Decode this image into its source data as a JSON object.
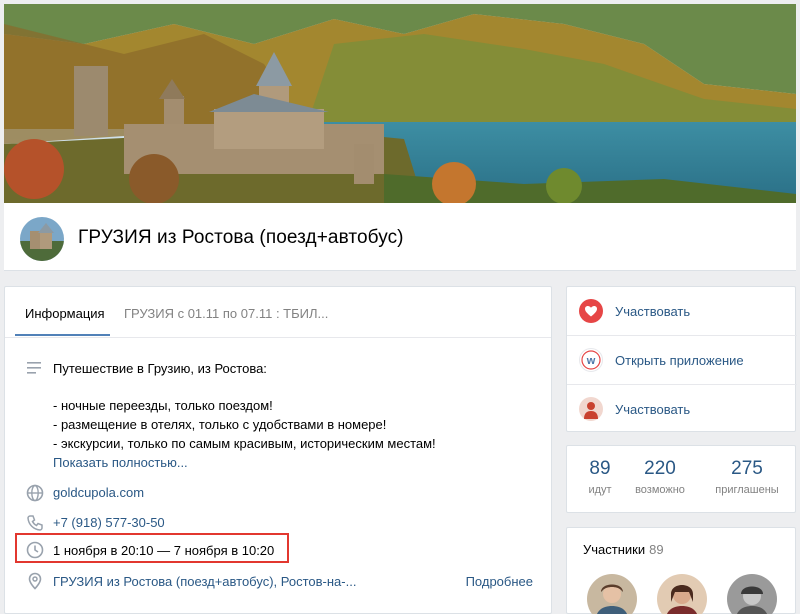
{
  "group": {
    "title": "ГРУЗИЯ из Ростова (поезд+автобус)"
  },
  "tabs": {
    "info": "Информация",
    "event": "ГРУЗИЯ с 01.11 по 07.11 : ТБИЛ..."
  },
  "description": {
    "lines": [
      "Путешествие в Грузию, из Ростова:",
      "- ночные переезды, только поездом!",
      "- размещение в отелях, только с удобствами в номере!",
      "- экскурсии, только по самым красивым, историческим местам!"
    ],
    "show_more": "Показать полностью..."
  },
  "details": {
    "website": "goldcupola.com",
    "phone": "+7 (918) 577-30-50",
    "dates": "1 ноября в 20:10 — 7 ноября в 10:20",
    "location": "ГРУЗИЯ из Ростова (поезд+автобус), Ростов-на-...",
    "location_more": "Подробнее"
  },
  "actions": {
    "participate": "Участвовать",
    "open_app": "Открыть приложение",
    "participate2": "Участвовать"
  },
  "stats": {
    "going": {
      "value": "89",
      "label": "идут"
    },
    "maybe": {
      "value": "220",
      "label": "возможно"
    },
    "invited": {
      "value": "275",
      "label": "приглашены"
    }
  },
  "members": {
    "title": "Участники",
    "count": "89"
  },
  "colors": {
    "accent": "#2a5885",
    "tab_underline": "#5181b8",
    "highlight_border": "#e2372f",
    "heart": "#e64646",
    "background": "#edeef0"
  },
  "icons": {
    "description": "text-lines-icon",
    "website": "globe-icon",
    "phone": "phone-icon",
    "dates": "clock-icon",
    "location": "location-pin-icon"
  }
}
